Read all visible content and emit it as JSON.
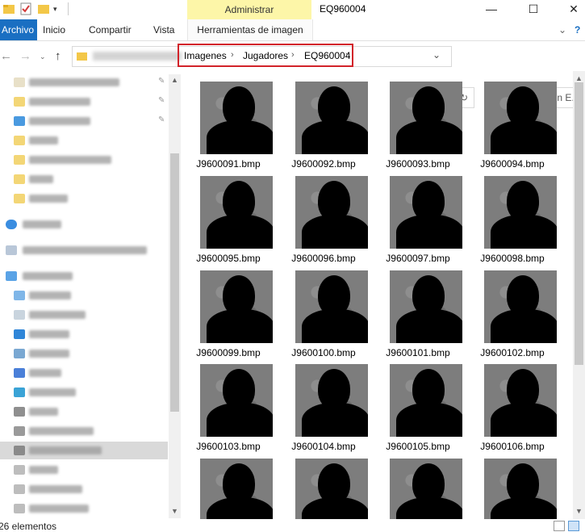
{
  "window": {
    "title": "EQ960004",
    "contextual_tab": "Administrar"
  },
  "ribbon": {
    "tabs": [
      "Archivo",
      "Inicio",
      "Compartir",
      "Vista"
    ],
    "contextual_tool_tab": "Herramientas de imagen"
  },
  "address": {
    "crumbs": [
      "Imagenes",
      "Jugadores",
      "EQ960004"
    ],
    "search_placeholder": "Buscar en E..."
  },
  "files": [
    "J9600091.bmp",
    "J9600092.bmp",
    "J9600093.bmp",
    "J9600094.bmp",
    "J9600095.bmp",
    "J9600096.bmp",
    "J9600097.bmp",
    "J9600098.bmp",
    "J9600099.bmp",
    "J9600100.bmp",
    "J9600101.bmp",
    "J9600102.bmp",
    "J9600103.bmp",
    "J9600104.bmp",
    "J9600105.bmp",
    "J9600106.bmp",
    "",
    "",
    "",
    ""
  ],
  "status": {
    "count": "26 elementos"
  },
  "colors": {
    "file_tab": "#1a6fc2",
    "contextual_tab": "#fdf6a8",
    "highlight_box": "#d2232a"
  }
}
